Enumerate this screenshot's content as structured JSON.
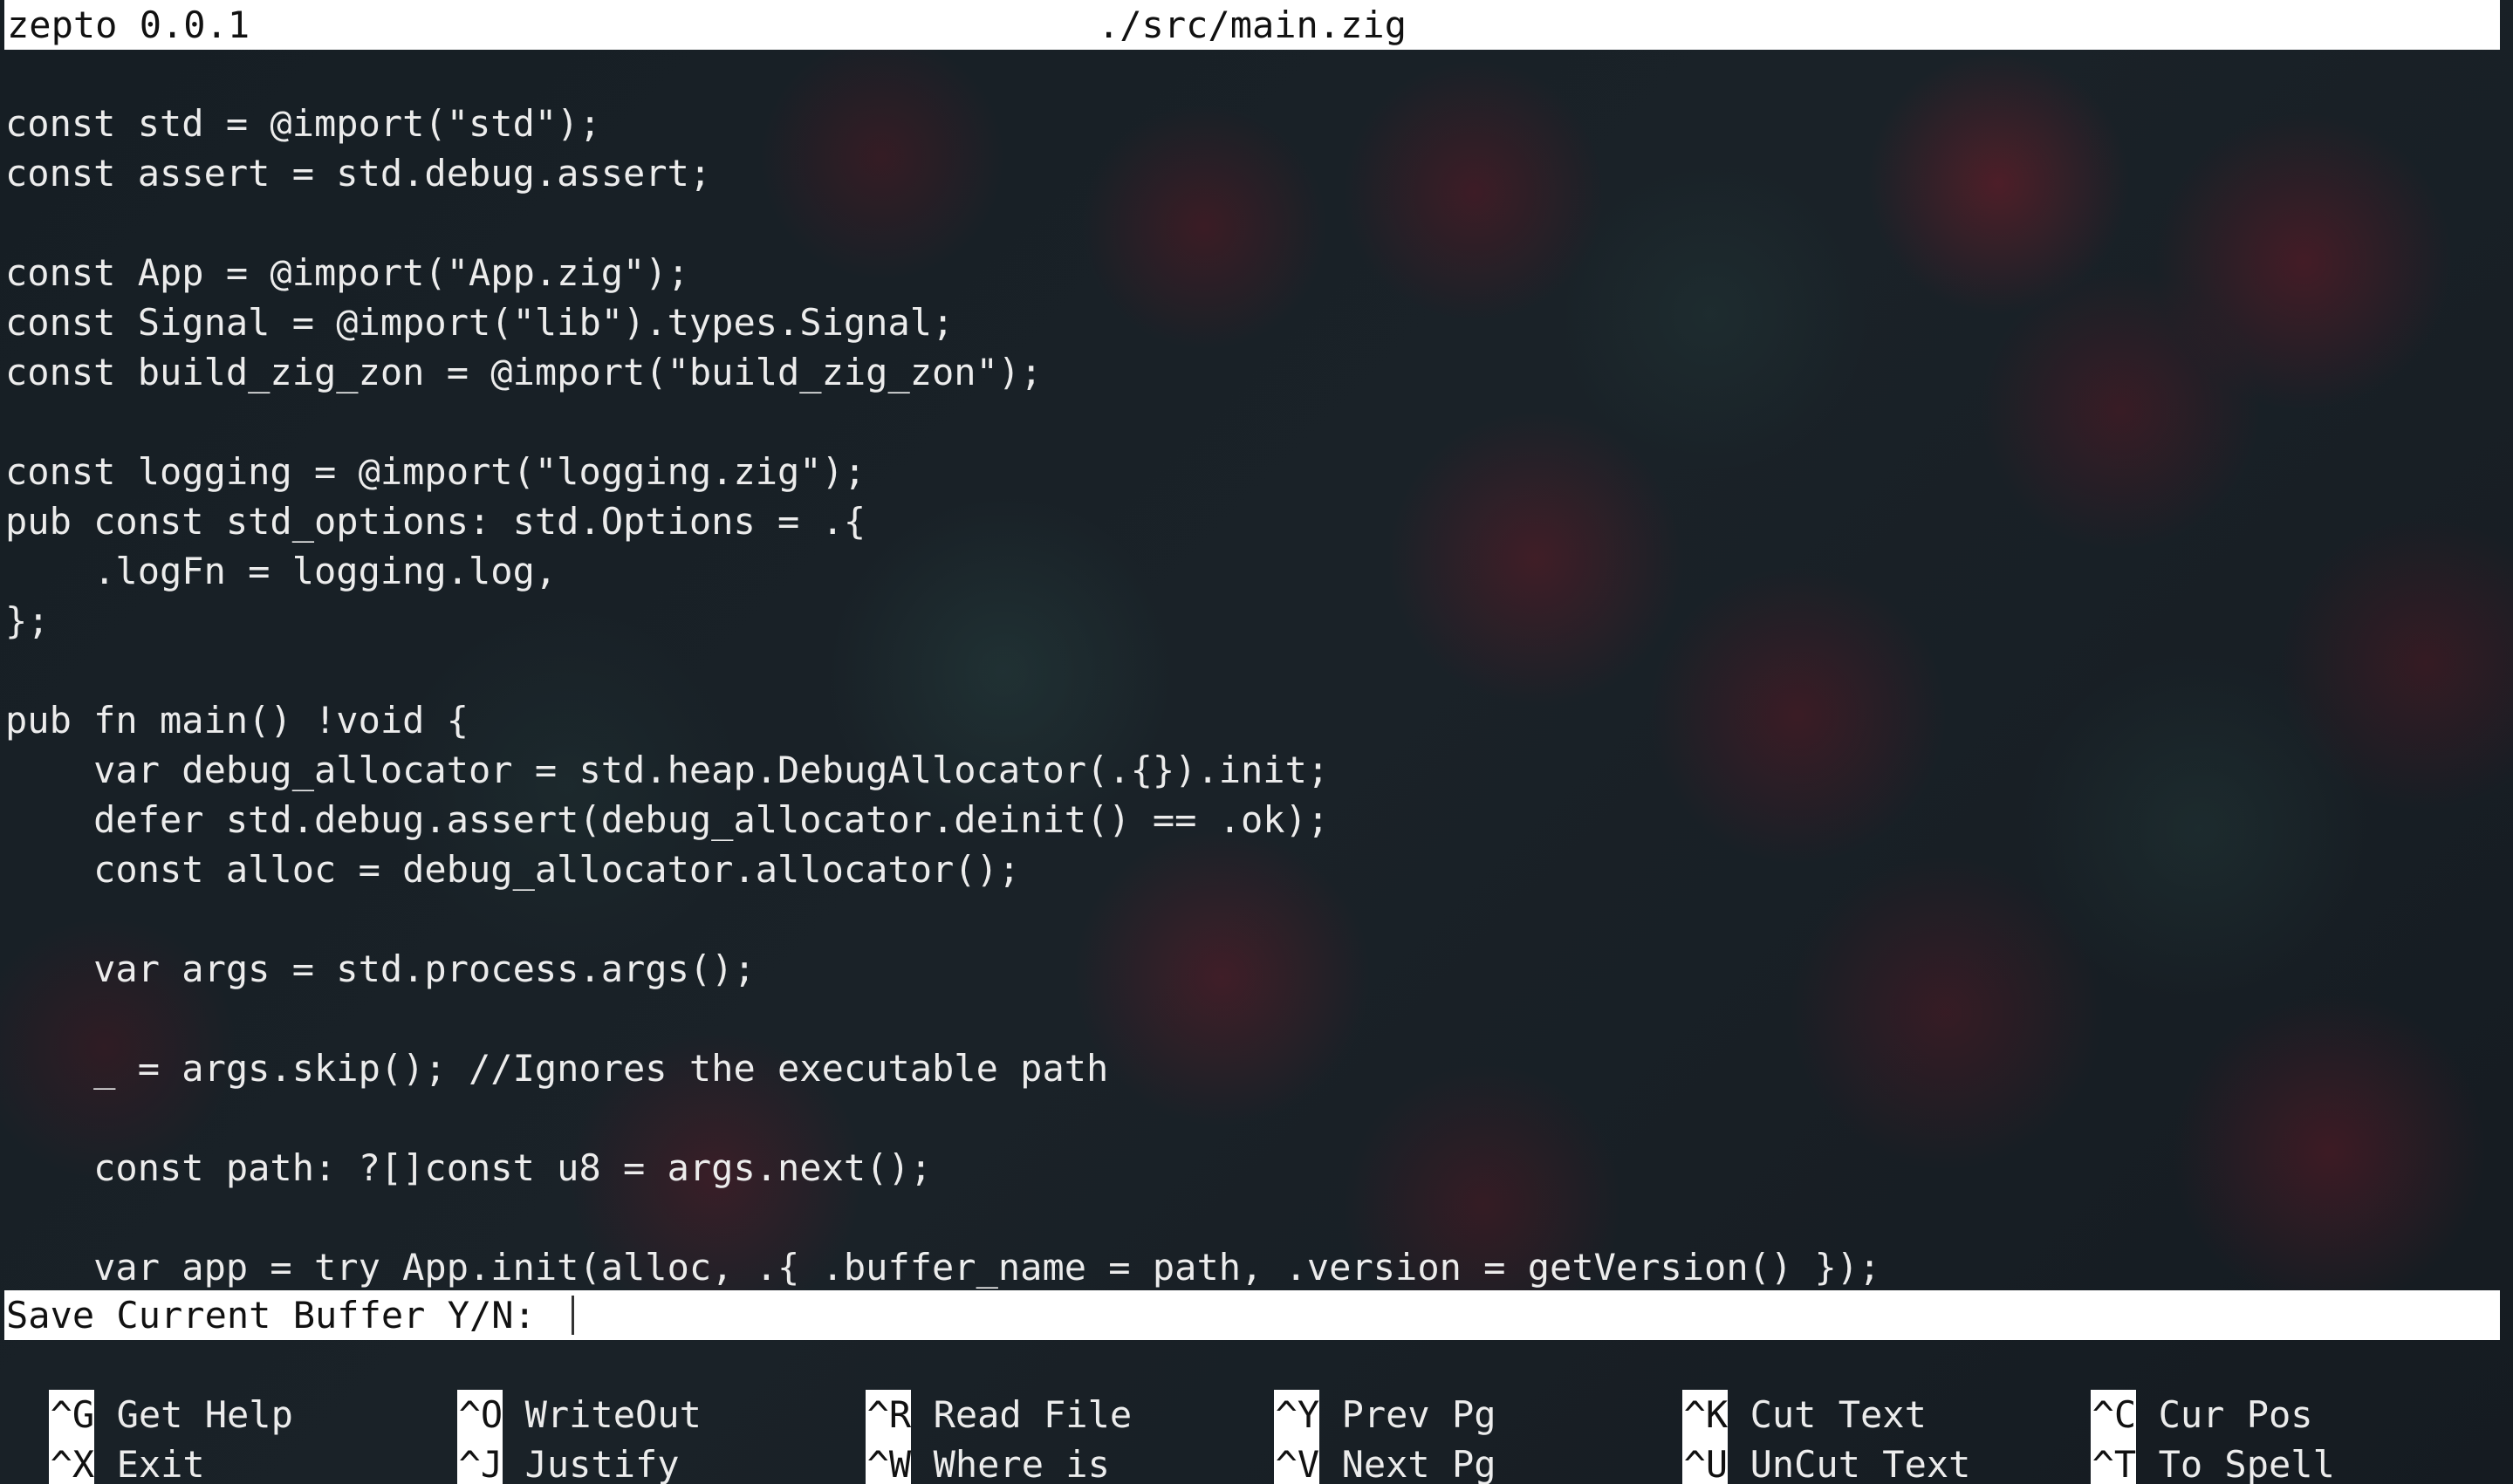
{
  "title_bar": {
    "app_version": "zepto 0.0.1",
    "file_path": "./src/main.zig"
  },
  "editor": {
    "lines": [
      "const std = @import(\"std\");",
      "const assert = std.debug.assert;",
      "",
      "const App = @import(\"App.zig\");",
      "const Signal = @import(\"lib\").types.Signal;",
      "const build_zig_zon = @import(\"build_zig_zon\");",
      "",
      "const logging = @import(\"logging.zig\");",
      "pub const std_options: std.Options = .{",
      "    .logFn = logging.log,",
      "};",
      "",
      "pub fn main() !void {",
      "    var debug_allocator = std.heap.DebugAllocator(.{}).init;",
      "    defer std.debug.assert(debug_allocator.deinit() == .ok);",
      "    const alloc = debug_allocator.allocator();",
      "",
      "    var args = std.process.args();",
      "",
      "    _ = args.skip(); //Ignores the executable path",
      "",
      "    const path: ?[]const u8 = args.next();",
      "",
      "    var app = try App.init(alloc, .{ .buffer_name = path, .version = getVersion() });"
    ]
  },
  "prompt": {
    "label": "Save Current Buffer Y/N:",
    "value": ""
  },
  "shortcuts": {
    "row1": [
      {
        "key": "^G",
        "label": "Get Help"
      },
      {
        "key": "^O",
        "label": "WriteOut"
      },
      {
        "key": "^R",
        "label": "Read File"
      },
      {
        "key": "^Y",
        "label": "Prev Pg"
      },
      {
        "key": "^K",
        "label": "Cut Text"
      },
      {
        "key": "^C",
        "label": "Cur Pos"
      }
    ],
    "row2": [
      {
        "key": "^X",
        "label": "Exit"
      },
      {
        "key": "^J",
        "label": "Justify"
      },
      {
        "key": "^W",
        "label": "Where is"
      },
      {
        "key": "^V",
        "label": "Next Pg"
      },
      {
        "key": "^U",
        "label": "UnCut Text"
      },
      {
        "key": "^T",
        "label": "To Spell"
      }
    ]
  },
  "colors": {
    "bar_background": "#ffffff",
    "bar_text": "#111111",
    "editor_text": "#ececec",
    "wallpaper_base": "#141c22",
    "wallpaper_accent": "#781c2a"
  }
}
